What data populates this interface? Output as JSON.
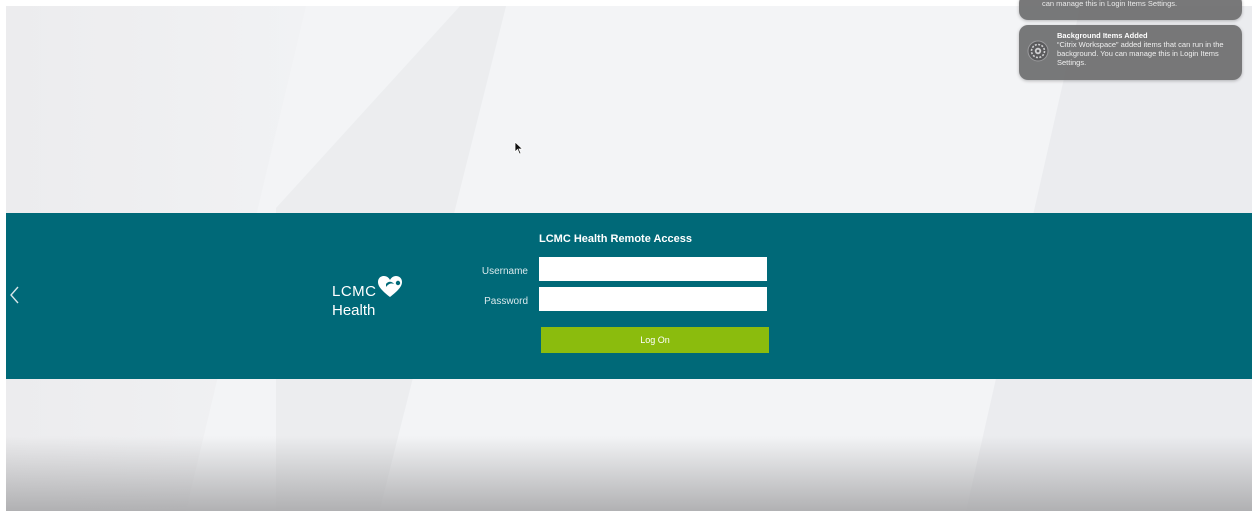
{
  "login": {
    "title": "LCMC Health Remote Access",
    "username_label": "Username",
    "password_label": "Password",
    "username_value": "",
    "password_value": "",
    "logon_label": "Log On"
  },
  "brand": {
    "line1": "LCMC",
    "line2": "Health",
    "band_color": "#006978",
    "button_color": "#8bbc0d"
  },
  "notifications": [
    {
      "body": "can manage this in Login Items Settings."
    },
    {
      "icon": "gear-icon",
      "title": "Background Items Added",
      "body": "“Citrix Workspace” added items that can run in the background. You can manage this in Login Items Settings."
    }
  ],
  "icons": {
    "prev": "chevron-left-icon",
    "cursor": "mouse-pointer-icon",
    "logo": "heart-logo-icon"
  }
}
